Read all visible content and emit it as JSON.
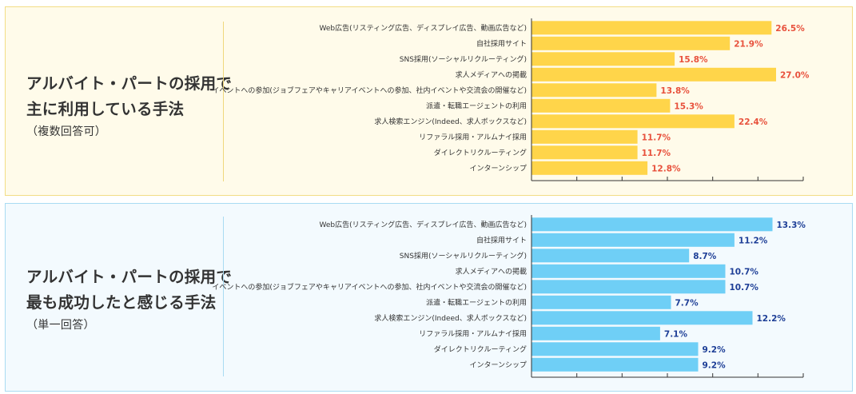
{
  "colors": {
    "panel1_bg": "#fffbea",
    "panel1_border": "#f2dd86",
    "panel1_bar": "#ffd54a",
    "panel1_value": "#e8513c",
    "panel1_divider": "#f0d77c",
    "panel2_bg": "#f3fafe",
    "panel2_border": "#a9dbf2",
    "panel2_bar": "#6fcff6",
    "panel2_value": "#1e3f97",
    "panel2_divider": "#a9dbf2",
    "axis": "#333333"
  },
  "panels": [
    {
      "title_line1": "アルバイト・パートの採用で",
      "title_line2": "主に利用している手法",
      "subtitle": "（複数回答可）"
    },
    {
      "title_line1": "アルバイト・パートの採用で",
      "title_line2": "最も成功したと感じる手法",
      "subtitle": "（単一回答）"
    }
  ],
  "chart_data": [
    {
      "type": "bar",
      "orientation": "horizontal",
      "categories": [
        "Web広告(リスティング広告、ディスプレイ広告、動画広告など)",
        "自社採用サイト",
        "SNS採用(ソーシャルリクルーティング)",
        "求人メディアへの掲載",
        "イベントへの参加(ジョブフェアやキャリアイベントへの参加、社内イベントや交流会の開催など)",
        "派遣・転職エージェントの利用",
        "求人検索エンジン(Indeed、求人ボックスなど)",
        "リファラル採用・アルムナイ採用",
        "ダイレクトリクルーティング",
        "インターンシップ"
      ],
      "values": [
        26.5,
        21.9,
        15.8,
        27.0,
        13.8,
        15.3,
        22.4,
        11.7,
        11.7,
        12.8
      ],
      "value_labels": [
        "26.5%",
        "21.9%",
        "15.8%",
        "27.0%",
        "13.8%",
        "15.3%",
        "22.4%",
        "11.7%",
        "11.7%",
        "12.8%"
      ],
      "xlim": [
        0,
        30
      ],
      "tick_step": 5,
      "tick_labels": "none"
    },
    {
      "type": "bar",
      "orientation": "horizontal",
      "categories": [
        "Web広告(リスティング広告、ディスプレイ広告、動画広告など)",
        "自社採用サイト",
        "SNS採用(ソーシャルリクルーティング)",
        "求人メディアへの掲載",
        "イベントへの参加(ジョブフェアやキャリアイベントへの参加、社内イベントや交流会の開催など)",
        "派遣・転職エージェントの利用",
        "求人検索エンジン(Indeed、求人ボックスなど)",
        "リファラル採用・アルムナイ採用",
        "ダイレクトリクルーティング",
        "インターンシップ"
      ],
      "values": [
        13.3,
        11.2,
        8.7,
        10.7,
        10.7,
        7.7,
        12.2,
        7.1,
        9.2,
        9.2
      ],
      "value_labels": [
        "13.3%",
        "11.2%",
        "8.7%",
        "10.7%",
        "10.7%",
        "7.7%",
        "12.2%",
        "7.1%",
        "9.2%",
        "9.2%"
      ],
      "xlim": [
        0,
        15
      ],
      "tick_step": 2.5,
      "tick_labels": "none"
    }
  ]
}
